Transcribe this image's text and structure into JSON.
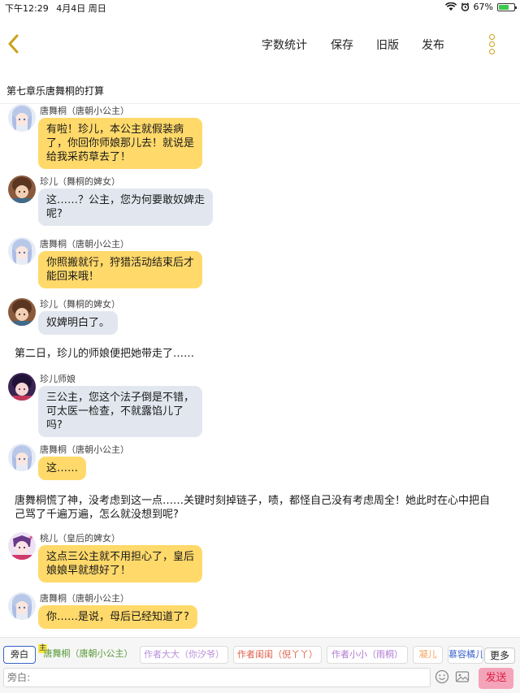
{
  "status_bar": {
    "time": "下午12:29",
    "date": "4月4日 周日",
    "battery": "67%",
    "battery_level": 0.67
  },
  "toolbar": {
    "word_count": "字数统计",
    "save": "保存",
    "old_version": "旧版",
    "publish": "发布"
  },
  "chapter": {
    "title": "第七章乐唐舞桐的打算"
  },
  "messages": [
    {
      "name": "唐舞桐（唐朝小公主）",
      "text": "有啦！珍儿，本公主就假装病\n了，你回你师娘那儿去！就说是\n给我采药草去了！"
    },
    {
      "name": "珍儿（舞桐的婢女）",
      "text": "这……？公主，您为何要敢奴婢走\n呢?"
    },
    {
      "name": "唐舞桐（唐朝小公主）",
      "text": "你照搬就行，狩猎活动结束后才\n能回来哦！"
    },
    {
      "name": "珍儿（舞桐的婢女）",
      "text": "奴婢明白了。"
    },
    {
      "narration": "第二日，珍儿的师娘便把她带走了……"
    },
    {
      "name": "珍儿师娘",
      "text": "三公主，您这个法子倒是不错，\n可太医一检查，不就露馅儿了\n吗?"
    },
    {
      "name": "唐舞桐（唐朝小公主）",
      "text": "这……"
    },
    {
      "narration": "唐舞桐慌了神，没考虑到这一点……关键时刻掉链子，啧，都怪自己没有考虑周全！她此时在心中把自\n己骂了千遍万遍，怎么就没想到呢?"
    },
    {
      "name": "桃儿（皇后的婢女）",
      "text": "这点三公主就不用担心了，皇后\n娘娘早就想好了！"
    },
    {
      "name": "唐舞桐（唐朝小公主）",
      "text": "你……是说，母后已经知道了?"
    }
  ],
  "role_bar": {
    "host_badge": "主",
    "roles": [
      {
        "label": "旁白",
        "color": "#222222"
      },
      {
        "label": "唐舞桐（唐朝小公主）",
        "color": "#5a9a3b"
      },
      {
        "label": "作者大大（你汐爷）",
        "color": "#b78fd9"
      },
      {
        "label": "作者闺闺（倪丫丫）",
        "color": "#e0604a"
      },
      {
        "label": "作者小小（雨桐）",
        "color": "#b07ad0"
      },
      {
        "label": "凝儿",
        "color": "#f2a15a"
      },
      {
        "label": "慕容橘儿",
        "color": "#3a63c7"
      }
    ],
    "more": "更多"
  },
  "input_bar": {
    "placeholder": "旁白:",
    "send": "发送"
  }
}
